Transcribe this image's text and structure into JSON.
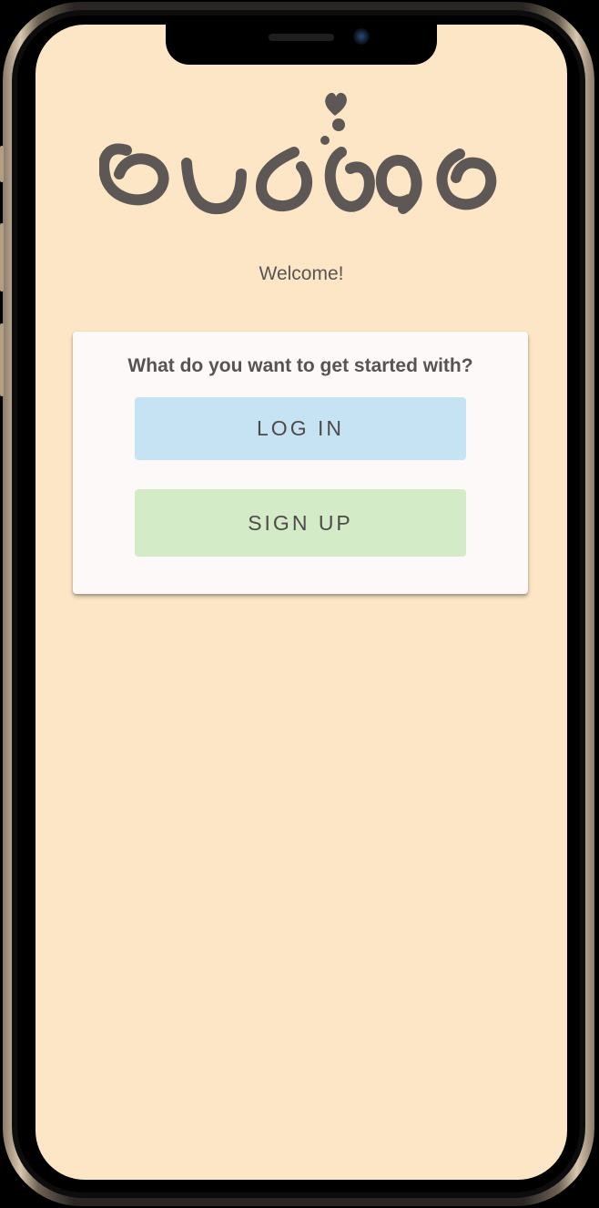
{
  "app": {
    "logo_text": "buddab",
    "logo_color": "#5d5856",
    "background_color": "#fce6c6"
  },
  "welcome": {
    "text": "Welcome!"
  },
  "start_card": {
    "prompt": "What do you want to get started with?",
    "login_label": "LOG IN",
    "signup_label": "SIGN UP",
    "login_color": "#c6e3f4",
    "signup_color": "#d3ebc6"
  }
}
